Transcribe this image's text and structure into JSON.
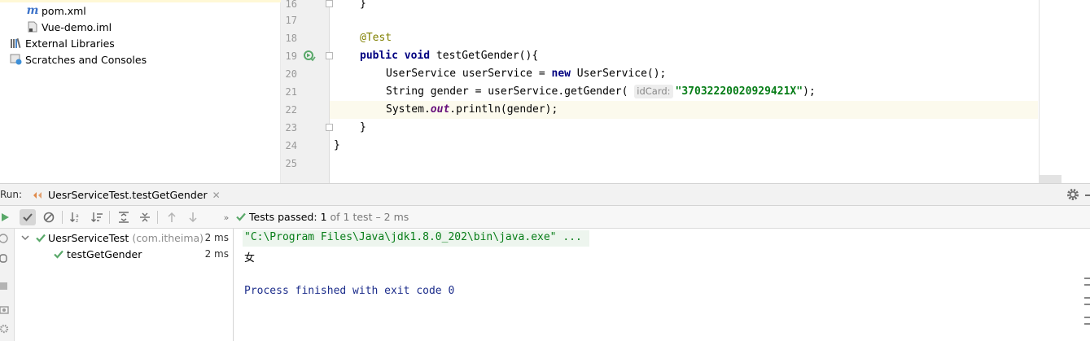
{
  "project_tree": {
    "items": [
      {
        "label": "pom.xml",
        "icon": "maven-file-icon"
      },
      {
        "label": "Vue-demo.iml",
        "icon": "module-file-icon"
      },
      {
        "label": "External Libraries",
        "icon": "library-icon"
      },
      {
        "label": "Scratches and Consoles",
        "icon": "scratches-icon"
      }
    ]
  },
  "editor": {
    "line_numbers": [
      "16",
      "17",
      "18",
      "19",
      "20",
      "21",
      "22",
      "23",
      "24",
      "25"
    ],
    "code": {
      "l16": "}",
      "l18_annotation": "@Test",
      "l19_public": "public",
      "l19_void": "void",
      "l19_rest": " testGetGender(){",
      "l20_a": "UserService userService = ",
      "l20_new": "new",
      "l20_b": " UserService();",
      "l21_a": "String gender = userService.getGender( ",
      "l21_hint": "idCard:",
      "l21_str": "\"37032220020929421X\"",
      "l21_b": ");",
      "l22_a": "System.",
      "l22_out": "out",
      "l22_b": ".println(gender);",
      "l23": "}",
      "l24": "}"
    },
    "current_line": "22"
  },
  "run_panel": {
    "label": "Run:",
    "tab_title": "UesrServiceTest.testGetGender",
    "status_passed": "Tests passed:",
    "status_count": "1",
    "status_rest": "of 1 test – 2 ms",
    "test_tree": [
      {
        "name": "UesrServiceTest",
        "package": "(com.itheima)",
        "time": "2 ms"
      },
      {
        "name": "testGetGender",
        "package": "",
        "time": "2 ms"
      }
    ],
    "console": [
      "\"C:\\Program Files\\Java\\jdk1.8.0_202\\bin\\java.exe\" ...",
      "女",
      "Process finished with exit code 0"
    ]
  },
  "colors": {
    "pass_green": "#59a869",
    "keyword": "#000080",
    "string": "#067d17",
    "console_cmd": "#067d17",
    "console_exit": "#1c2d8b"
  }
}
